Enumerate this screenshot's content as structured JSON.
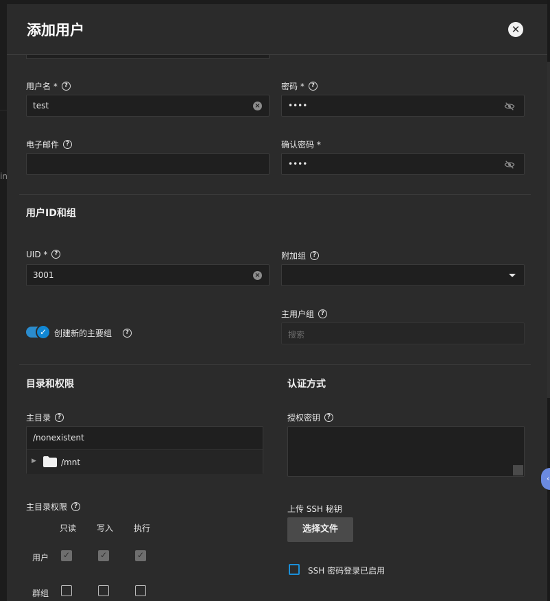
{
  "dialog": {
    "title": "添加用户",
    "close_glyph": "✕"
  },
  "form": {
    "username": {
      "label": "用户名 *",
      "value": "test"
    },
    "password": {
      "label": "密码 *",
      "value": "••••"
    },
    "email": {
      "label": "电子邮件",
      "value": ""
    },
    "confirm_password": {
      "label": "确认密码 *",
      "value": "••••"
    }
  },
  "section_ids": {
    "title": "用户ID和组",
    "uid": {
      "label": "UID *",
      "value": "3001"
    },
    "aux_groups": {
      "label": "附加组",
      "value": ""
    },
    "create_group": {
      "label": "创建新的主要组",
      "checked": true
    },
    "primary_group": {
      "label": "主用户组",
      "placeholder": "搜索"
    }
  },
  "section_dirs": {
    "title": "目录和权限",
    "home_dir": {
      "label": "主目录",
      "value": "/nonexistent",
      "tree_item": "/mnt"
    },
    "permissions": {
      "label": "主目录权限",
      "columns": [
        "只读",
        "写入",
        "执行"
      ],
      "rows": [
        {
          "name": "用户",
          "checked": [
            true,
            true,
            true
          ]
        },
        {
          "name": "群组",
          "checked": [
            false,
            false,
            false
          ]
        }
      ]
    }
  },
  "section_auth": {
    "title": "认证方式",
    "auth_key": {
      "label": "授权密钥",
      "value": ""
    },
    "upload_label": "上传 SSH 秘钥",
    "choose_file": "选择文件",
    "ssh_password_login": {
      "label": "SSH 密码登录已启用",
      "checked": false
    }
  },
  "backdrop": {
    "fragment": "in"
  },
  "icons": {
    "help": "question-circle-icon",
    "clear": "clear-circle-icon",
    "visibility": "eye-off-icon",
    "dropdown": "caret-down-icon",
    "folder": "folder-icon",
    "check": "check-icon"
  },
  "colors": {
    "accent": "#1187d4",
    "panel": "#2b2b2b",
    "input": "#1f1f1f"
  }
}
